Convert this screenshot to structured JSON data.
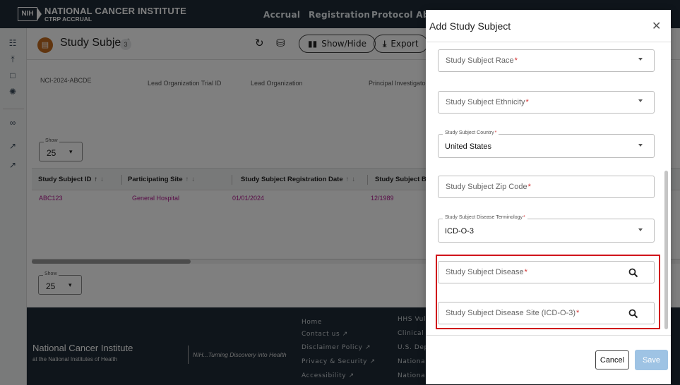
{
  "header": {
    "logo_badge": "NIH",
    "brand_name": "NATIONAL CANCER INSTITUTE",
    "brand_sub": "CTRP ACCRUAL",
    "nav": [
      "Accrual",
      "Registration",
      "Protocol Abst"
    ]
  },
  "page": {
    "title": "Study Subject",
    "count": "3",
    "subject_icon": "document-icon",
    "toolbar": {
      "refresh_icon": "refresh-icon",
      "lock_icon": "lock-open-icon",
      "show_hide_label": "Show/Hide",
      "export_label": "Export"
    },
    "filters": [
      "NCI-2024-ABCDE",
      "Lead Organization Trial ID",
      "Lead Organization",
      "Principal Investigato"
    ],
    "show_label": "Show",
    "show_value": "25",
    "table": {
      "columns": [
        {
          "label": "Study Subject ID"
        },
        {
          "label": "Participating Site"
        },
        {
          "label": "Study Subject Registration Date"
        },
        {
          "label": "Study Subject Bi"
        }
      ],
      "rows": [
        {
          "id": "ABC123",
          "site": "General Hospital",
          "reg_date": "01/01/2024",
          "birth": "12/1989"
        }
      ]
    },
    "bottom_show_label": "Show",
    "bottom_show_value": "25"
  },
  "footer": {
    "org_name": "National Cancer Institute",
    "org_sub": "at the National Institutes of Health",
    "tagline": "NIH...Turning Discovery into Health",
    "links_col1": [
      "Home",
      "Contact us",
      "Disclaimer Policy",
      "Privacy & Security",
      "Accessibility"
    ],
    "links_col2": [
      "HHS Vul",
      "Clinical",
      "U.S. Dep",
      "National",
      "National"
    ]
  },
  "modal": {
    "title": "Add Study Subject",
    "close_icon": "close-icon",
    "fields": {
      "race": {
        "placeholder": "Study Subject Race"
      },
      "ethnicity": {
        "placeholder": "Study Subject Ethnicity"
      },
      "country": {
        "legend": "Study Subject Country",
        "value": "United States"
      },
      "zip": {
        "placeholder": "Study Subject Zip Code"
      },
      "terminology": {
        "legend": "Study Subject Disease Terminology",
        "value": "ICD-O-3"
      },
      "disease": {
        "placeholder": "Study Subject Disease"
      },
      "disease_site": {
        "placeholder": "Study Subject Disease Site (ICD-O-3)"
      }
    },
    "required_mark": "*",
    "cancel_label": "Cancel",
    "save_label": "Save"
  },
  "colors": {
    "header_bg": "#1e2a36",
    "link_magenta": "#b0168e",
    "required_red": "#d32f2f",
    "highlight_red": "#d0141b",
    "save_disabled": "#9ec3e4"
  }
}
